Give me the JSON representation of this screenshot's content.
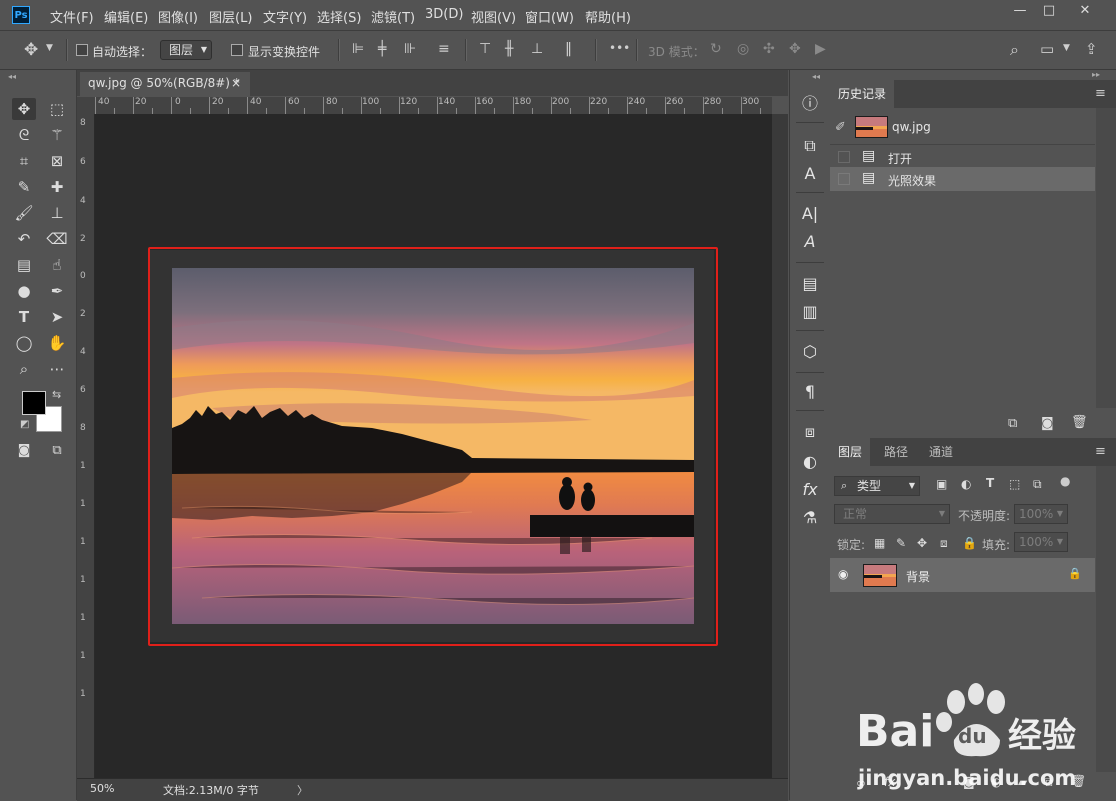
{
  "app": {
    "logo": "Ps"
  },
  "menu": [
    "文件(F)",
    "编辑(E)",
    "图像(I)",
    "图层(L)",
    "文字(Y)",
    "选择(S)",
    "滤镜(T)",
    "3D(D)",
    "视图(V)",
    "窗口(W)",
    "帮助(H)"
  ],
  "window_controls": {
    "minimize": "—",
    "maximize": "□",
    "close": "✕"
  },
  "options": {
    "auto_select_label": "自动选择：",
    "auto_select_value": "图层",
    "show_transform_label": "显示变换控件",
    "mode3d_label": "3D 模式：",
    "more": "•••"
  },
  "document": {
    "tab_title": "qw.jpg @ 50%(RGB/8#) *",
    "tab_close": "×",
    "ruler_top": [
      "40",
      "20",
      "0",
      "20",
      "40",
      "60",
      "80",
      "100",
      "120",
      "140",
      "160",
      "180",
      "200",
      "220",
      "240",
      "260",
      "280",
      "300"
    ],
    "ruler_left": [
      "8",
      "6",
      "4",
      "2",
      "0",
      "2",
      "4",
      "6",
      "8",
      "1",
      "1",
      "1",
      "1",
      "1",
      "1",
      "1"
    ],
    "zoom": "50%",
    "doc_info": "文档:2.13M/0 字节",
    "status_arrow": "〉"
  },
  "history_panel": {
    "tab": "历史记录",
    "snapshot_name": "qw.jpg",
    "items": [
      {
        "label": "打开",
        "selected": false
      },
      {
        "label": "光照效果",
        "selected": true
      }
    ]
  },
  "layers_panel": {
    "tabs": [
      "图层",
      "路径",
      "通道"
    ],
    "filter_kind": "类型",
    "blend_mode": "正常",
    "opacity_label": "不透明度:",
    "opacity_value": "100%",
    "lock_label": "锁定:",
    "fill_label": "填充:",
    "fill_value": "100%",
    "layers": [
      {
        "name": "背景",
        "locked": true,
        "visible": true
      }
    ]
  },
  "watermark": {
    "brand": "Bai",
    "brand2": "du",
    "brand_cn": "经验",
    "url": "jingyan.baidu.com"
  },
  "colors": {
    "accent_red": "#e0201a",
    "ps_blue": "#31a8ff",
    "panel": "#535353",
    "dark": "#282828"
  }
}
